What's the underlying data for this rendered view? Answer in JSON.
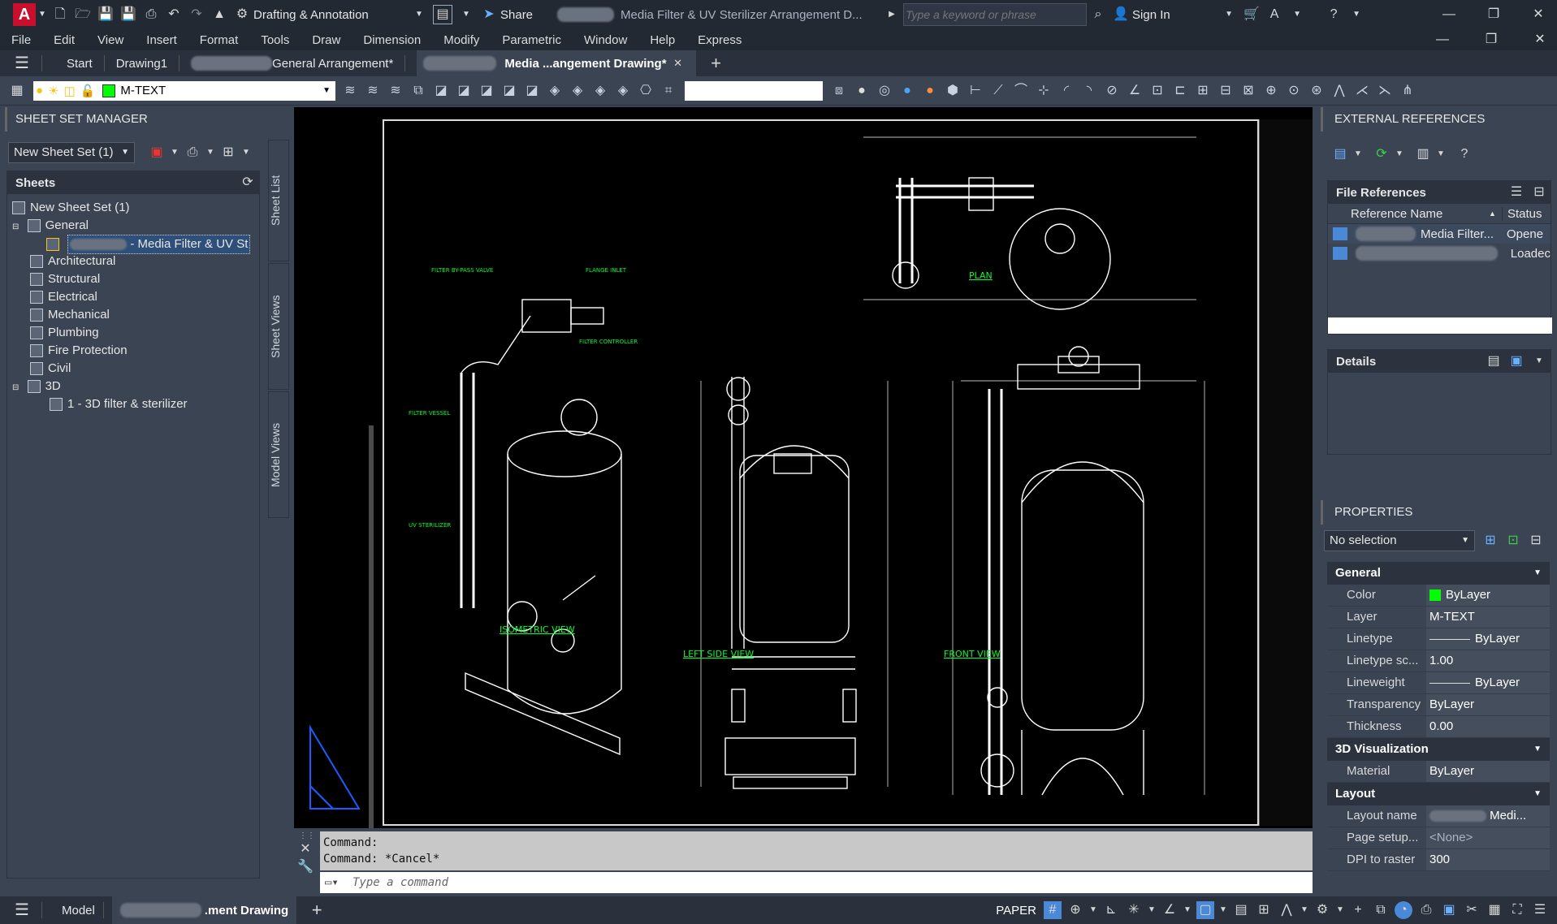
{
  "titlebar": {
    "logo": "A",
    "workspace": "Drafting & Annotation",
    "share": "Share",
    "doc_title": "Media Filter & UV Sterilizer Arrangement D...",
    "search_placeholder": "Type a keyword or phrase",
    "sign_in": "Sign In"
  },
  "menu": [
    "File",
    "Edit",
    "View",
    "Insert",
    "Format",
    "Tools",
    "Draw",
    "Dimension",
    "Modify",
    "Parametric",
    "Window",
    "Help",
    "Express"
  ],
  "tabs": {
    "start": "Start",
    "drawing1": "Drawing1",
    "general": "General Arrangement*",
    "active": "Media ...angement Drawing*"
  },
  "toolbar": {
    "layer": "M-TEXT"
  },
  "ssm": {
    "title": "SHEET SET MANAGER",
    "sheetset": "New Sheet Set (1)",
    "sheets_header": "Sheets",
    "root": "New Sheet Set (1)",
    "items": [
      {
        "label": "General"
      },
      {
        "label": "- Media Filter & UV St"
      },
      {
        "label": "Architectural"
      },
      {
        "label": "Structural"
      },
      {
        "label": "Electrical"
      },
      {
        "label": "Mechanical"
      },
      {
        "label": "Plumbing"
      },
      {
        "label": "Fire Protection"
      },
      {
        "label": "Civil"
      },
      {
        "label": "3D"
      },
      {
        "label": "1 - 3D filter & sterilizer"
      }
    ],
    "side_tabs": [
      "Sheet List",
      "Sheet Views",
      "Model Views"
    ]
  },
  "drawing": {
    "views": [
      "ISOMETRIC VIEW",
      "LEFT SIDE VIEW",
      "FRONT VIEW",
      "PLAN"
    ],
    "labels": [
      "FILTER VESSEL",
      "FILTER CONTROLLER",
      "UV STERILIZER",
      "FILTER BY-PASS VALVE",
      "FLANGE INLET"
    ]
  },
  "xref": {
    "title": "EXTERNAL REFERENCES",
    "file_refs": "File References",
    "col_name": "Reference Name",
    "col_status": "Status",
    "rows": [
      {
        "name": "Media Filter...",
        "status": "Opene"
      },
      {
        "name": "",
        "status": "Loadec"
      }
    ],
    "details": "Details"
  },
  "properties": {
    "title": "PROPERTIES",
    "selection": "No selection",
    "general": "General",
    "color_k": "Color",
    "color_v": "ByLayer",
    "layer_k": "Layer",
    "layer_v": "M-TEXT",
    "linetype_k": "Linetype",
    "linetype_v": "ByLayer",
    "ltscale_k": "Linetype sc...",
    "ltscale_v": "1.00",
    "lineweight_k": "Lineweight",
    "lineweight_v": "ByLayer",
    "transparency_k": "Transparency",
    "transparency_v": "ByLayer",
    "thickness_k": "Thickness",
    "thickness_v": "0.00",
    "viz": "3D Visualization",
    "material_k": "Material",
    "material_v": "ByLayer",
    "layout": "Layout",
    "layoutname_k": "Layout name",
    "layoutname_v": "Medi...",
    "pagesetup_k": "Page setup...",
    "pagesetup_v": "<None>",
    "dpi_k": "DPI to raster",
    "dpi_v": "300",
    "accent_color": "#00ff00"
  },
  "command": {
    "line1": "Command:",
    "line2": "Command: *Cancel*",
    "placeholder": "Type a command"
  },
  "status": {
    "model": "Model",
    "layout_tab": ".ment Drawing",
    "paper": "PAPER"
  }
}
